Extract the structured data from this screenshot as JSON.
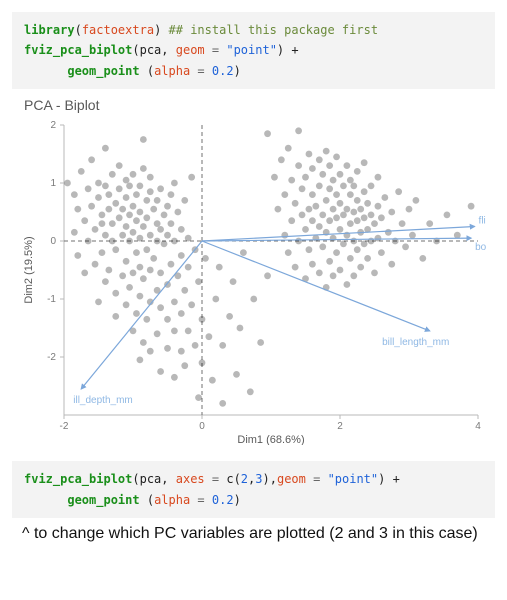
{
  "code1": {
    "line1": {
      "kw": "library",
      "open": "(",
      "arg": "factoextra",
      "close": ")",
      "comment": "## install this package first"
    },
    "line2": {
      "fn": "fviz_pca_biplot",
      "open": "(",
      "a1": "pca",
      "sep": ", ",
      "argn": "geom",
      "eq": " = ",
      "val": "\"point\"",
      "close": ")",
      "plus": " +"
    },
    "line3": {
      "indent": "      ",
      "fn": "geom_point",
      "open": " (",
      "argn": "alpha",
      "eq": " = ",
      "val": "0.2",
      "close": ")"
    }
  },
  "code2": {
    "line1": {
      "fn": "fviz_pca_biplot",
      "open": "(",
      "a1": "pca",
      "sep1": ", ",
      "argn1": "axes",
      "eq1": " = ",
      "val1a": "c(",
      "val1b": "2",
      "val1c": ",",
      "val1d": "3",
      "val1e": ")",
      "sep2": ",",
      "argn2": "geom",
      "eq2": " = ",
      "val2": "\"point\"",
      "close": ")",
      "plus": " +"
    },
    "line2": {
      "indent": "      ",
      "fn": "geom_point",
      "open": " (",
      "argn": "alpha",
      "eq": " = ",
      "val": "0.2",
      "close": ")"
    }
  },
  "caption": "^ to change which PC variables are plotted (2 and 3 in this case)",
  "chart_data": {
    "type": "scatter",
    "title": "PCA - Biplot",
    "xlabel": "Dim1 (68.6%)",
    "ylabel": "Dim2 (19.5%)",
    "xlim": [
      -2,
      4
    ],
    "ylim": [
      -3,
      2
    ],
    "xticks": [
      -2,
      0,
      2,
      4
    ],
    "yticks": [
      -2,
      -1,
      0,
      1,
      2
    ],
    "grid": false,
    "zero_lines": true,
    "vectors": [
      {
        "name": "flipper_length_…",
        "x": 3.95,
        "y": 0.25
      },
      {
        "name": "body_mass_g",
        "x": 3.9,
        "y": 0.05
      },
      {
        "name": "bill_length_mm",
        "x": 3.3,
        "y": -1.55
      },
      {
        "name": "bill_depth_mm",
        "x": -1.75,
        "y": -2.55
      }
    ],
    "label_hints": {
      "bill_depth_mm": "ill_depth_mm"
    },
    "points": [
      [
        -1.95,
        1.0
      ],
      [
        -1.85,
        0.15
      ],
      [
        -1.85,
        0.8
      ],
      [
        -1.8,
        -0.25
      ],
      [
        -1.8,
        0.55
      ],
      [
        -1.75,
        1.2
      ],
      [
        -1.7,
        0.35
      ],
      [
        -1.7,
        -0.55
      ],
      [
        -1.65,
        0.0
      ],
      [
        -1.65,
        0.9
      ],
      [
        -1.6,
        0.6
      ],
      [
        -1.6,
        1.4
      ],
      [
        -1.55,
        -0.4
      ],
      [
        -1.55,
        0.2
      ],
      [
        -1.5,
        -1.05
      ],
      [
        -1.5,
        0.75
      ],
      [
        -1.5,
        1.0
      ],
      [
        -1.45,
        -0.2
      ],
      [
        -1.45,
        0.3
      ],
      [
        -1.45,
        0.45
      ],
      [
        -1.4,
        -0.7
      ],
      [
        -1.4,
        0.1
      ],
      [
        -1.4,
        0.95
      ],
      [
        -1.4,
        1.6
      ],
      [
        -1.35,
        -0.5
      ],
      [
        -1.35,
        0.55
      ],
      [
        -1.35,
        0.8
      ],
      [
        -1.3,
        0.0
      ],
      [
        -1.3,
        0.3
      ],
      [
        -1.3,
        1.15
      ],
      [
        -1.25,
        -1.3
      ],
      [
        -1.25,
        -0.9
      ],
      [
        -1.25,
        -0.15
      ],
      [
        -1.25,
        0.65
      ],
      [
        -1.2,
        0.4
      ],
      [
        -1.2,
        0.9
      ],
      [
        -1.2,
        1.3
      ],
      [
        -1.15,
        -0.6
      ],
      [
        -1.15,
        0.1
      ],
      [
        -1.15,
        0.55
      ],
      [
        -1.1,
        -1.1
      ],
      [
        -1.1,
        -0.35
      ],
      [
        -1.1,
        0.25
      ],
      [
        -1.1,
        0.75
      ],
      [
        -1.1,
        1.05
      ],
      [
        -1.05,
        -0.8
      ],
      [
        -1.05,
        0.0
      ],
      [
        -1.05,
        0.45
      ],
      [
        -1.05,
        0.95
      ],
      [
        -1.0,
        -1.55
      ],
      [
        -1.0,
        -0.55
      ],
      [
        -1.0,
        0.15
      ],
      [
        -1.0,
        0.6
      ],
      [
        -1.0,
        1.15
      ],
      [
        -0.95,
        -1.25
      ],
      [
        -0.95,
        -0.2
      ],
      [
        -0.95,
        0.35
      ],
      [
        -0.95,
        0.8
      ],
      [
        -0.9,
        -2.05
      ],
      [
        -0.9,
        -0.95
      ],
      [
        -0.9,
        -0.45
      ],
      [
        -0.9,
        0.05
      ],
      [
        -0.9,
        0.5
      ],
      [
        -0.9,
        0.95
      ],
      [
        -0.85,
        -1.75
      ],
      [
        -0.85,
        -0.65
      ],
      [
        -0.85,
        0.25
      ],
      [
        -0.85,
        1.25
      ],
      [
        -0.85,
        1.75
      ],
      [
        -0.8,
        -1.35
      ],
      [
        -0.8,
        -0.15
      ],
      [
        -0.8,
        0.4
      ],
      [
        -0.8,
        0.7
      ],
      [
        -0.75,
        -1.9
      ],
      [
        -0.75,
        -1.05
      ],
      [
        -0.75,
        -0.5
      ],
      [
        -0.75,
        0.1
      ],
      [
        -0.75,
        0.85
      ],
      [
        -0.75,
        1.1
      ],
      [
        -0.7,
        -0.3
      ],
      [
        -0.7,
        0.55
      ],
      [
        -0.65,
        -1.6
      ],
      [
        -0.65,
        -0.85
      ],
      [
        -0.65,
        0.0
      ],
      [
        -0.65,
        0.3
      ],
      [
        -0.65,
        0.7
      ],
      [
        -0.6,
        -2.25
      ],
      [
        -0.6,
        -1.15
      ],
      [
        -0.6,
        -0.55
      ],
      [
        -0.6,
        0.2
      ],
      [
        -0.6,
        0.9
      ],
      [
        -0.55,
        -0.05
      ],
      [
        -0.55,
        0.45
      ],
      [
        -0.5,
        -1.85
      ],
      [
        -0.5,
        -1.35
      ],
      [
        -0.5,
        -0.75
      ],
      [
        -0.5,
        0.1
      ],
      [
        -0.5,
        0.6
      ],
      [
        -0.45,
        -0.4
      ],
      [
        -0.45,
        0.3
      ],
      [
        -0.45,
        0.8
      ],
      [
        -0.4,
        -2.35
      ],
      [
        -0.4,
        -1.55
      ],
      [
        -0.4,
        -1.05
      ],
      [
        -0.4,
        0.0
      ],
      [
        -0.4,
        1.0
      ],
      [
        -0.35,
        -0.6
      ],
      [
        -0.35,
        0.5
      ],
      [
        -0.3,
        -1.9
      ],
      [
        -0.3,
        -1.25
      ],
      [
        -0.3,
        -0.25
      ],
      [
        -0.3,
        0.2
      ],
      [
        -0.25,
        -2.15
      ],
      [
        -0.25,
        -0.85
      ],
      [
        -0.25,
        0.7
      ],
      [
        -0.2,
        -1.55
      ],
      [
        -0.2,
        -0.45
      ],
      [
        -0.2,
        0.05
      ],
      [
        -0.15,
        -1.1
      ],
      [
        -0.15,
        1.1
      ],
      [
        -0.1,
        -1.8
      ],
      [
        -0.1,
        -0.15
      ],
      [
        -0.05,
        -2.7
      ],
      [
        -0.05,
        -0.7
      ],
      [
        0.0,
        -2.1
      ],
      [
        0.0,
        -1.35
      ],
      [
        0.05,
        -0.3
      ],
      [
        0.1,
        -1.65
      ],
      [
        0.15,
        -2.4
      ],
      [
        0.2,
        -1.0
      ],
      [
        0.25,
        -0.45
      ],
      [
        0.3,
        -2.8
      ],
      [
        0.3,
        -1.8
      ],
      [
        0.4,
        -1.3
      ],
      [
        0.45,
        -0.7
      ],
      [
        0.5,
        -2.3
      ],
      [
        0.55,
        -1.5
      ],
      [
        0.6,
        -0.2
      ],
      [
        0.7,
        -2.6
      ],
      [
        0.75,
        -1.0
      ],
      [
        0.85,
        -1.75
      ],
      [
        0.95,
        -0.6
      ],
      [
        0.95,
        1.85
      ],
      [
        1.05,
        1.1
      ],
      [
        1.1,
        0.55
      ],
      [
        1.15,
        1.4
      ],
      [
        1.2,
        0.1
      ],
      [
        1.2,
        0.8
      ],
      [
        1.25,
        -0.2
      ],
      [
        1.25,
        1.6
      ],
      [
        1.3,
        0.35
      ],
      [
        1.3,
        1.05
      ],
      [
        1.35,
        -0.45
      ],
      [
        1.35,
        0.65
      ],
      [
        1.4,
        0.0
      ],
      [
        1.4,
        1.3
      ],
      [
        1.4,
        1.9
      ],
      [
        1.45,
        0.45
      ],
      [
        1.45,
        0.9
      ],
      [
        1.5,
        -0.65
      ],
      [
        1.5,
        0.2
      ],
      [
        1.5,
        1.1
      ],
      [
        1.55,
        -0.15
      ],
      [
        1.55,
        0.55
      ],
      [
        1.55,
        1.5
      ],
      [
        1.6,
        -0.4
      ],
      [
        1.6,
        0.35
      ],
      [
        1.6,
        0.8
      ],
      [
        1.6,
        1.25
      ],
      [
        1.65,
        0.05
      ],
      [
        1.65,
        0.6
      ],
      [
        1.7,
        -0.55
      ],
      [
        1.7,
        0.25
      ],
      [
        1.7,
        0.95
      ],
      [
        1.7,
        1.4
      ],
      [
        1.75,
        -0.1
      ],
      [
        1.75,
        0.45
      ],
      [
        1.75,
        1.15
      ],
      [
        1.8,
        -0.8
      ],
      [
        1.8,
        0.15
      ],
      [
        1.8,
        0.7
      ],
      [
        1.8,
        1.55
      ],
      [
        1.85,
        -0.35
      ],
      [
        1.85,
        0.35
      ],
      [
        1.85,
        0.9
      ],
      [
        1.85,
        1.3
      ],
      [
        1.9,
        -0.6
      ],
      [
        1.9,
        0.05
      ],
      [
        1.9,
        0.55
      ],
      [
        1.9,
        1.05
      ],
      [
        1.95,
        -0.2
      ],
      [
        1.95,
        0.4
      ],
      [
        1.95,
        0.8
      ],
      [
        1.95,
        1.45
      ],
      [
        2.0,
        -0.5
      ],
      [
        2.0,
        0.2
      ],
      [
        2.0,
        0.65
      ],
      [
        2.0,
        1.15
      ],
      [
        2.05,
        -0.05
      ],
      [
        2.05,
        0.45
      ],
      [
        2.05,
        0.95
      ],
      [
        2.1,
        -0.75
      ],
      [
        2.1,
        0.1
      ],
      [
        2.1,
        0.55
      ],
      [
        2.1,
        1.3
      ],
      [
        2.15,
        -0.3
      ],
      [
        2.15,
        0.3
      ],
      [
        2.15,
        0.8
      ],
      [
        2.15,
        1.05
      ],
      [
        2.2,
        -0.6
      ],
      [
        2.2,
        0.0
      ],
      [
        2.2,
        0.5
      ],
      [
        2.2,
        0.95
      ],
      [
        2.25,
        -0.15
      ],
      [
        2.25,
        0.35
      ],
      [
        2.25,
        0.7
      ],
      [
        2.25,
        1.2
      ],
      [
        2.3,
        -0.45
      ],
      [
        2.3,
        0.15
      ],
      [
        2.3,
        0.55
      ],
      [
        2.35,
        -0.05
      ],
      [
        2.35,
        0.4
      ],
      [
        2.35,
        0.85
      ],
      [
        2.35,
        1.35
      ],
      [
        2.4,
        -0.3
      ],
      [
        2.4,
        0.2
      ],
      [
        2.4,
        0.65
      ],
      [
        2.45,
        0.0
      ],
      [
        2.45,
        0.45
      ],
      [
        2.45,
        0.95
      ],
      [
        2.5,
        -0.55
      ],
      [
        2.5,
        0.3
      ],
      [
        2.55,
        0.05
      ],
      [
        2.55,
        0.6
      ],
      [
        2.55,
        1.1
      ],
      [
        2.6,
        -0.2
      ],
      [
        2.6,
        0.4
      ],
      [
        2.65,
        0.75
      ],
      [
        2.7,
        0.15
      ],
      [
        2.75,
        -0.4
      ],
      [
        2.75,
        0.5
      ],
      [
        2.8,
        0.0
      ],
      [
        2.85,
        0.85
      ],
      [
        2.9,
        0.3
      ],
      [
        2.95,
        -0.1
      ],
      [
        3.0,
        0.55
      ],
      [
        3.05,
        0.1
      ],
      [
        3.1,
        0.7
      ],
      [
        3.2,
        -0.3
      ],
      [
        3.3,
        0.3
      ],
      [
        3.4,
        0.0
      ],
      [
        3.55,
        0.45
      ],
      [
        3.7,
        0.1
      ],
      [
        3.9,
        0.6
      ]
    ]
  }
}
